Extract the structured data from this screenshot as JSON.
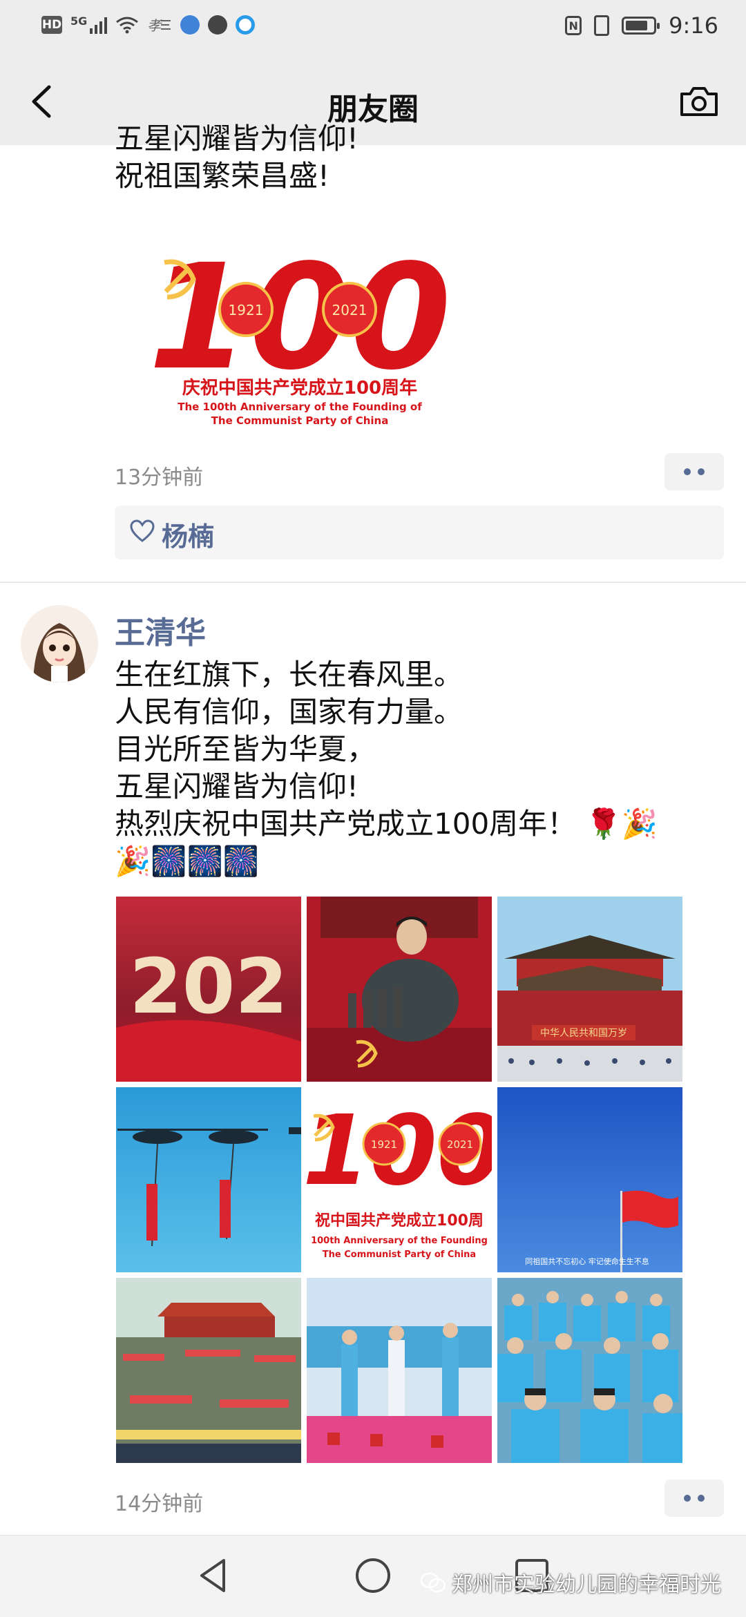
{
  "status_bar": {
    "time": "9:16",
    "hd_label": "HD",
    "network_label": "5G",
    "battery_level": 0.8
  },
  "nav": {
    "title": "朋友圈",
    "back_icon": "chevron-left-icon",
    "camera_icon": "camera-icon"
  },
  "post1": {
    "text_lines": [
      "五星闪耀皆为信仰!",
      "祝祖国繁荣昌盛!"
    ],
    "image": {
      "number": "100",
      "year_left": "1921",
      "year_right": "2021",
      "caption_cn": "庆祝中国共产党成立100周年",
      "caption_en_1": "The 100th Anniversary of the Founding of",
      "caption_en_2": "The Communist Party of China"
    },
    "time": "13分钟前",
    "likes": "杨楠"
  },
  "post2": {
    "author": "王清华",
    "text_lines": [
      "生在红旗下，长在春风里。",
      "人民有信仰，国家有力量。",
      "目光所至皆为华夏，",
      "五星闪耀皆为信仰!",
      "热烈庆祝中国共产党成立100周年！ 🌹🎉",
      "🎉🎆🎆🎆"
    ],
    "photos": {
      "p1_text": "202",
      "p3_banner": "中华人民共和国万岁",
      "p5_number": "100",
      "p5_year_left": "1921",
      "p5_year_right": "2021",
      "p5_caption_cn": "祝中国共产党成立100周",
      "p5_caption_en_1": "100th Anniversary of the Founding",
      "p5_caption_en_2": "The Communist Party of China",
      "p6_caption": "同祖国共不忘初心 牢记使命生生不息"
    },
    "time": "14分钟前"
  },
  "bottom_nav": {
    "watermark": "郑州市实验幼儿园的幸福时光"
  },
  "colors": {
    "link": "#576b95",
    "party_red": "#d7141a",
    "gold": "#f6c24a"
  }
}
